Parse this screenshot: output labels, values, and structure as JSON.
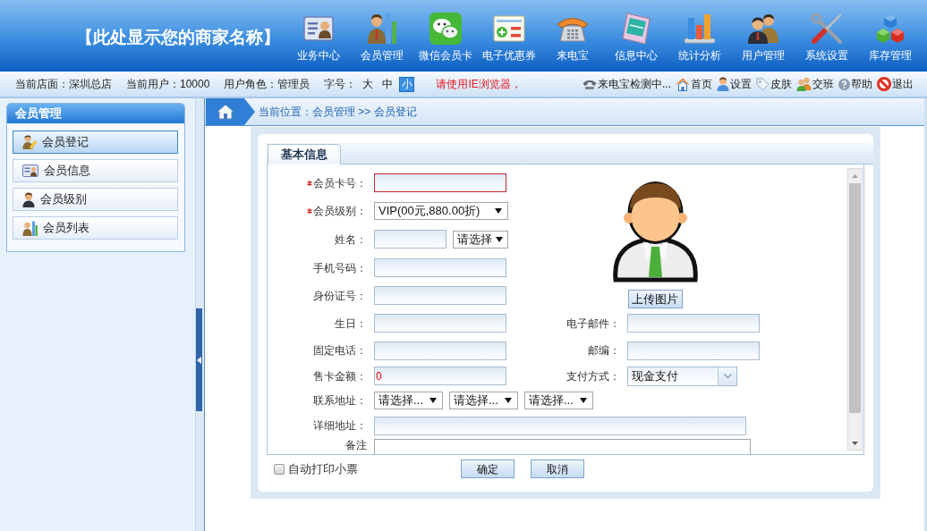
{
  "header": {
    "title": "【此处显示您的商家名称】",
    "nav": [
      "业务中心",
      "会员管理",
      "微信会员卡",
      "电子优惠券",
      "来电宝",
      "信息中心",
      "统计分析",
      "用户管理",
      "系统设置",
      "库存管理"
    ]
  },
  "status_bar": {
    "info": [
      "当前店面：深圳总店",
      "当前用户：10000",
      "用户角色：管理员"
    ],
    "font_size": {
      "label": "字号：",
      "options": [
        {
          "label": "大",
          "selected": false
        },
        {
          "label": "中",
          "selected": false
        },
        {
          "label": "小",
          "selected": true
        }
      ]
    },
    "notice": "请使用IE浏览器，",
    "links": [
      "来电宝检测中...",
      "首页",
      "设置",
      "皮肤",
      "交班",
      "帮助",
      "退出"
    ]
  },
  "sidebar": {
    "title": "会员管理",
    "items": [
      {
        "label": "会员登记",
        "selected": true
      },
      {
        "label": "会员信息",
        "selected": false
      },
      {
        "label": "会员级别",
        "selected": false
      },
      {
        "label": "会员列表",
        "selected": false
      }
    ]
  },
  "breadcrumb": "当前位置：会员管理 >> 会员登记",
  "form": {
    "tabs": [
      {
        "label": "基本信息",
        "selected": true
      }
    ],
    "rows": [
      {
        "fields": [
          {
            "kind": "input",
            "label": "会员卡号：",
            "required": true,
            "error": true
          }
        ]
      },
      {
        "fields": [
          {
            "kind": "select",
            "label": "会员级别：",
            "required": true,
            "error": false,
            "value": "VIP(00元,880.00折)"
          }
        ]
      },
      {
        "fields": [
          {
            "kind": "name",
            "label": "姓名：",
            "required": false,
            "error": false,
            "option": "请选择"
          }
        ]
      },
      {
        "fields": [
          {
            "kind": "input",
            "label": "手机号码：",
            "required": false,
            "error": false
          }
        ]
      },
      {
        "fields": [
          {
            "kind": "input",
            "label": "身份证号：",
            "required": false,
            "error": false
          }
        ]
      },
      {
        "fields": [
          {
            "kind": "input",
            "label": "生日：",
            "required": false,
            "error": false
          },
          {
            "kind": "input",
            "label": "电子邮件：",
            "required": false,
            "error": false
          }
        ]
      },
      {
        "fields": [
          {
            "kind": "input",
            "label": "固定电话：",
            "required": false,
            "error": false
          },
          {
            "kind": "input",
            "label": "邮编：",
            "required": false,
            "error": false
          }
        ]
      },
      {
        "fields": [
          {
            "kind": "input",
            "label": "售卡金额：",
            "required": false,
            "error": false,
            "value": "0"
          },
          {
            "kind": "combo",
            "label": "支付方式：",
            "required": false,
            "error": false,
            "value": "现金支付"
          }
        ]
      },
      {
        "fields": [
          {
            "kind": "address",
            "label": "联系地址：",
            "required": false,
            "error": false,
            "options": [
              "请选择...",
              "请选择...",
              "请选择..."
            ]
          }
        ]
      },
      {
        "fields": [
          {
            "kind": "wide",
            "label": "详细地址：",
            "required": false,
            "error": false
          }
        ]
      },
      {
        "fields": [
          {
            "kind": "textarea",
            "label": "备注",
            "required": false,
            "error": false
          }
        ]
      }
    ],
    "upload_button": "上传图片",
    "auto_print": {
      "label": "自动打印小票",
      "checked": false
    },
    "buttons": [
      "确定",
      "取消"
    ]
  }
}
